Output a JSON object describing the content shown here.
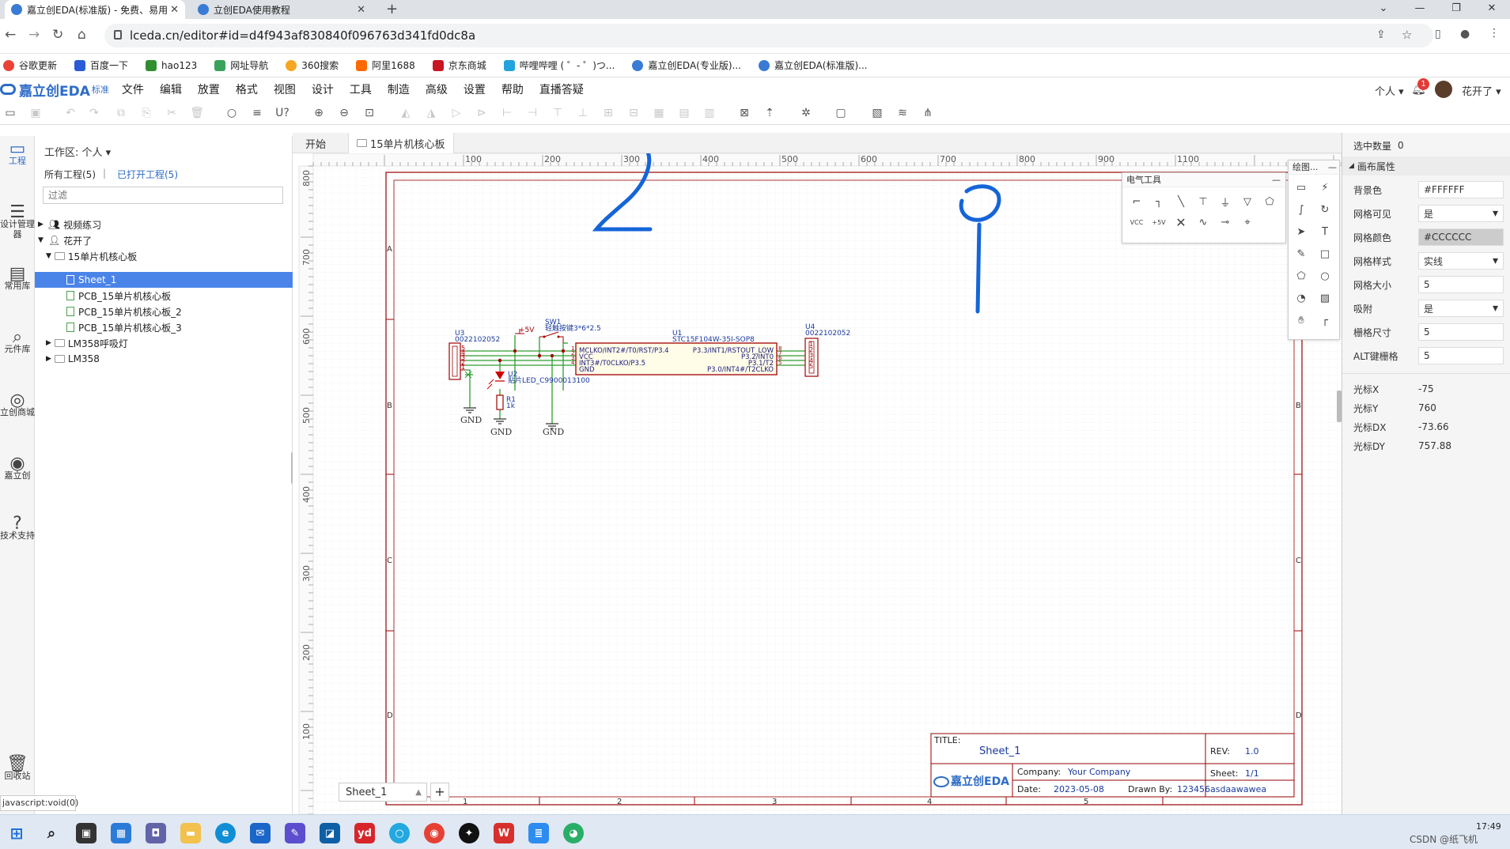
{
  "browser": {
    "tabs": [
      {
        "title": "嘉立创EDA(标准版) - 免费、易用",
        "active": true
      },
      {
        "title": "立创EDA使用教程",
        "active": false
      }
    ],
    "url": "lceda.cn/editor#id=d4f943af830840f096763d341fd0dc8a",
    "bookmarks": [
      "谷歌更新",
      "百度一下",
      "hao123",
      "网址导航",
      "360搜索",
      "阿里1688",
      "京东商城",
      "哔哩哔哩 ( ゜- ゜)つ...",
      "嘉立创EDA(专业版)...",
      "嘉立创EDA(标准版)..."
    ]
  },
  "app": {
    "logo": "嘉立创EDA",
    "logo_suffix": "标准",
    "menu": [
      "文件",
      "编辑",
      "放置",
      "格式",
      "视图",
      "设计",
      "工具",
      "制造",
      "高级",
      "设置",
      "帮助",
      "直播答疑"
    ],
    "account_label": "个人",
    "notif_count": "1",
    "username": "花开了"
  },
  "rail": [
    "工程",
    "设计管理器",
    "常用库",
    "元件库",
    "立创商城",
    "嘉立创",
    "技术支持",
    "回收站"
  ],
  "project": {
    "workspace": "工作区: 个人",
    "all_projects": "所有工程(5)",
    "separator": "|",
    "open_projects": "已打开工程(5)",
    "filter_placeholder": "过滤",
    "tree": [
      "视频练习",
      "花开了",
      "15单片机核心板",
      "Sheet_1",
      "PCB_15单片机核心板",
      "PCB_15单片机核心板_2",
      "PCB_15单片机核心板_3",
      "LM358呼吸灯",
      "LM358"
    ]
  },
  "statusbar": "javascript:void(0)",
  "doc_tabs": [
    "开始",
    "15单片机核心板"
  ],
  "sheet_tab": "Sheet_1",
  "sheet_add": "+",
  "ruler": {
    "top": [
      "100",
      "200",
      "300",
      "400",
      "500",
      "600",
      "700",
      "800",
      "900",
      "1100"
    ],
    "left": [
      "800",
      "700",
      "600",
      "500",
      "400",
      "300",
      "200",
      "100"
    ]
  },
  "border_labels": {
    "cols": [
      "1",
      "2",
      "3",
      "4",
      "5"
    ],
    "rows": [
      "A",
      "B",
      "C",
      "D"
    ]
  },
  "title_block": {
    "title_label": "TITLE:",
    "title": "Sheet_1",
    "rev_label": "REV:",
    "rev": "1.0",
    "company_label": "Company:",
    "company": "Your Company",
    "sheet_label": "Sheet:",
    "sheet": "1/1",
    "date_label": "Date:",
    "date": "2023-05-08",
    "drawn_label": "Drawn By:",
    "drawn": "123456asdaawawea",
    "logo": "嘉立创EDA"
  },
  "schematic": {
    "u3_ref": "U3",
    "u3_val": "0022102052",
    "u3_pins": [
      "5",
      "4",
      "3",
      "2",
      "1"
    ],
    "sw_ref": "SW1",
    "sw_val": "轻触按键3*6*2.5",
    "vcc_label": "+5V",
    "u1_ref": "U1",
    "u1_val": "STC15F104W-35I-SOP8",
    "u1_left": [
      "MCLKO/INT2#/T0/RST/P3.4",
      "VCC",
      "INT3#/T0CLKO/P3.5",
      "GND"
    ],
    "u1_right": [
      "P3.3/INT1/RSTOUT_LOW",
      "P3.2/INT0",
      "P3.1/T2",
      "P3.0/INT4#/T2CLKO"
    ],
    "u1_lpins": [
      "1",
      "2",
      "3",
      "4"
    ],
    "u1_rpins": [
      "8",
      "7",
      "6",
      "5"
    ],
    "u4_ref": "U4",
    "u4_val": "0022102052",
    "u4_pins": [
      "1",
      "2",
      "3",
      "4",
      "5"
    ],
    "u2_ref": "U2",
    "u2_val": "贴片LED_C9900013100",
    "r1_ref": "R1",
    "r1_val": "1k",
    "gnd": "GND"
  },
  "annotations": [
    "2",
    "1"
  ],
  "electric_tools": {
    "title": "电气工具",
    "vcc": "VCC",
    "plus5v": "+5V"
  },
  "drawing_tools": {
    "title": "绘图..."
  },
  "properties": {
    "selected_label": "选中数量",
    "selected": "0",
    "section": "画布属性",
    "rows": [
      {
        "label": "背景色",
        "value": "#FFFFFF"
      },
      {
        "label": "网格可见",
        "value": "是"
      },
      {
        "label": "网格颜色",
        "value": "#CCCCCC"
      },
      {
        "label": "网格样式",
        "value": "实线"
      },
      {
        "label": "网格大小",
        "value": "5"
      },
      {
        "label": "吸附",
        "value": "是"
      },
      {
        "label": "栅格尺寸",
        "value": "5"
      },
      {
        "label": "ALT键栅格",
        "value": "5"
      }
    ],
    "cursor": [
      {
        "label": "光标X",
        "value": "-75"
      },
      {
        "label": "光标Y",
        "value": "760"
      },
      {
        "label": "光标DX",
        "value": "-73.66"
      },
      {
        "label": "光标DY",
        "value": "757.88"
      }
    ]
  },
  "taskbar": {
    "clock": "17:49",
    "watermark": "CSDN @纸飞机"
  },
  "colors": {
    "accent": "#2e6cc7",
    "wire": "#2e9e2e",
    "part": "#a00000",
    "annotation": "#1565d8",
    "border": "#990000"
  }
}
